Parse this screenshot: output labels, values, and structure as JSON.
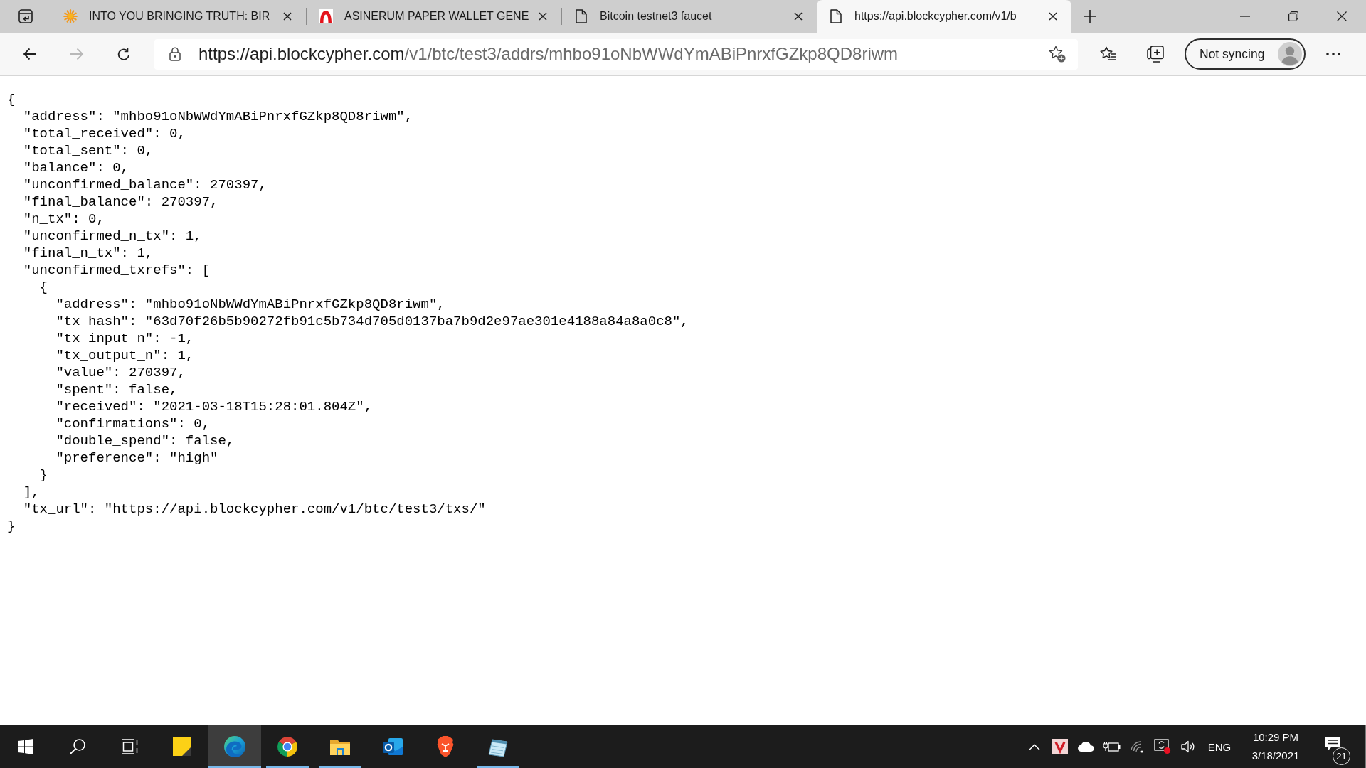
{
  "tab_strip": {
    "tabs": [
      {
        "title": "INTO YOU BRINGING TRUTH: BIR",
        "kind": "sunburst",
        "selected": false
      },
      {
        "title": "ASINERUM PAPER WALLET GENE",
        "kind": "arch",
        "selected": false
      },
      {
        "title": "Bitcoin testnet3 faucet",
        "kind": "page",
        "selected": false
      },
      {
        "title": "https://api.blockcypher.com/v1/b",
        "kind": "page",
        "selected": true
      }
    ]
  },
  "toolbar": {
    "buttons": [
      {
        "kind": "back",
        "disabled": false
      },
      {
        "kind": "forward",
        "disabled": true
      },
      {
        "kind": "reload",
        "disabled": false
      }
    ],
    "address_bar": {
      "url_host": "https://api.blockcypher.com",
      "url_path": "/v1/btc/test3/addrs/mhbo91oNbWWdYmABiPnrxfGZkp8QD8riwm"
    },
    "profile": {
      "label": "Not syncing"
    }
  },
  "page": {
    "lines": [
      {
        "text": "{",
        "children": [
          {
            "text": "\"address\": \"mhbo91oNbWWdYmABiPnrxfGZkp8QD8riwm\","
          },
          {
            "text": "\"total_received\": 0,"
          },
          {
            "text": "\"total_sent\": 0,"
          },
          {
            "text": "\"balance\": 0,"
          },
          {
            "text": "\"unconfirmed_balance\": 270397,"
          },
          {
            "text": "\"final_balance\": 270397,"
          },
          {
            "text": "\"n_tx\": 0,"
          },
          {
            "text": "\"unconfirmed_n_tx\": 1,"
          },
          {
            "text": "\"final_n_tx\": 1,"
          },
          {
            "text": "\"unconfirmed_txrefs\": [",
            "children": [
              {
                "text": "{",
                "children": [
                  {
                    "text": "\"address\": \"mhbo91oNbWWdYmABiPnrxfGZkp8QD8riwm\","
                  },
                  {
                    "text": "\"tx_hash\": \"63d70f26b5b90272fb91c5b734d705d0137ba7b9d2e97ae301e4188a84a8a0c8\","
                  },
                  {
                    "text": "\"tx_input_n\": -1,"
                  },
                  {
                    "text": "\"tx_output_n\": 1,"
                  },
                  {
                    "text": "\"value\": 270397,"
                  },
                  {
                    "text": "\"spent\": false,"
                  },
                  {
                    "text": "\"received\": \"2021-03-18T15:28:01.804Z\","
                  },
                  {
                    "text": "\"confirmations\": 0,"
                  },
                  {
                    "text": "\"double_spend\": false,"
                  },
                  {
                    "text": "\"preference\": \"high\""
                  }
                ]
              },
              {
                "text": "}"
              }
            ]
          },
          {
            "text": "],"
          },
          {
            "text": "\"tx_url\": \"https://api.blockcypher.com/v1/btc/test3/txs/\""
          }
        ]
      },
      {
        "text": "}"
      }
    ]
  },
  "taskbar": {
    "apps": [
      {
        "kind": "note",
        "running": false,
        "selected": false
      },
      {
        "kind": "wave",
        "running": true,
        "selected": true
      },
      {
        "kind": "ring",
        "running": true,
        "selected": false
      },
      {
        "kind": "folder",
        "running": true,
        "selected": false
      },
      {
        "kind": "mail",
        "running": false,
        "selected": false
      },
      {
        "kind": "shield",
        "running": false,
        "selected": false
      },
      {
        "kind": "notepad",
        "running": true,
        "selected": false
      }
    ],
    "language": "ENG",
    "time": "10:29 PM",
    "date": "3/18/2021",
    "notification_count": "21"
  }
}
